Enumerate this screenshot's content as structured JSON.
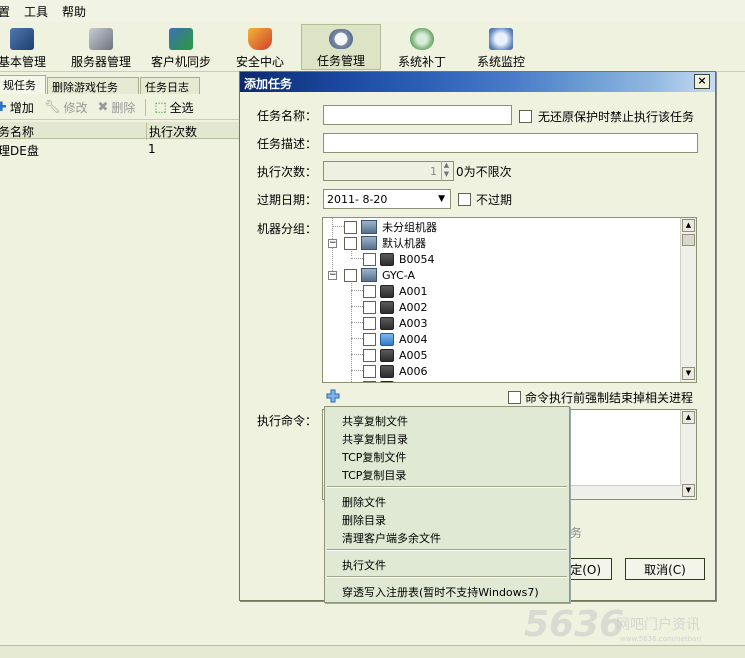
{
  "menubar": {
    "items": [
      "置",
      "工具",
      "帮助"
    ]
  },
  "toolbar": {
    "buttons": [
      {
        "label": "基本管理",
        "icon": "gear-monitor-icon"
      },
      {
        "label": "服务器管理",
        "icon": "server-icon"
      },
      {
        "label": "客户机同步",
        "icon": "sync-icon"
      },
      {
        "label": "安全中心",
        "icon": "shield-icon"
      },
      {
        "label": "任务管理",
        "icon": "task-clock-icon",
        "active": true
      },
      {
        "label": "系统补丁",
        "icon": "patch-icon"
      },
      {
        "label": "系统监控",
        "icon": "monitor-icon"
      }
    ]
  },
  "tabs": [
    {
      "label": "规任务",
      "active": true
    },
    {
      "label": "删除游戏任务"
    },
    {
      "label": "任务日志"
    }
  ],
  "actions": {
    "add": "增加",
    "edit": "修改",
    "delete": "删除",
    "select_all": "全选"
  },
  "grid": {
    "columns": [
      "务名称",
      "执行次数"
    ],
    "rows": [
      {
        "name": "理DE盘",
        "count": "1"
      }
    ]
  },
  "dialog": {
    "title": "添加任务",
    "close": "×",
    "name_label": "任务名称：",
    "no_protect_label": "无还原保护时禁止执行该任务",
    "desc_label": "任务描述：",
    "count_label": "执行次数：",
    "count_value": "1",
    "count_hint": "0为不限次",
    "expire_label": "过期日期：",
    "expire_value": "2011- 8-20",
    "no_expire_label": "不过期",
    "machines_label": "机器分组：",
    "tree": [
      {
        "label": "未分组机器",
        "type": "group",
        "level": 0
      },
      {
        "label": "默认机器",
        "type": "group",
        "level": 0,
        "expanded": true
      },
      {
        "label": "B0054",
        "type": "pc",
        "level": 1
      },
      {
        "label": "GYC-A",
        "type": "group",
        "level": 0,
        "expanded": true
      },
      {
        "label": "A001",
        "type": "pc",
        "level": 1
      },
      {
        "label": "A002",
        "type": "pc",
        "level": 1
      },
      {
        "label": "A003",
        "type": "pc",
        "level": 1
      },
      {
        "label": "A004",
        "type": "pc",
        "level": 1,
        "selected": true
      },
      {
        "label": "A005",
        "type": "pc",
        "level": 1
      },
      {
        "label": "A006",
        "type": "pc",
        "level": 1
      }
    ],
    "force_kill_label": "命令执行前强制结束掉相关进程",
    "command_label": "执行命令：",
    "partial_task_text": "务",
    "ok_label": "确定(O)",
    "ok_label_partial": "确定(O)",
    "cancel_label": "取消(C)"
  },
  "context_menu": {
    "groups": [
      [
        "共享复制文件",
        "共享复制目录",
        "TCP复制文件",
        "TCP复制目录"
      ],
      [
        "删除文件",
        "删除目录",
        "清理客户端多余文件"
      ],
      [
        "执行文件"
      ],
      [
        "穿透写入注册表(暂时不支持Windows7)"
      ]
    ]
  },
  "watermark": {
    "number": "5636",
    "text": "网吧门户资讯",
    "url": "www.5636.com/netbar/"
  },
  "colors": {
    "background": "#eef2df",
    "title_dark": "#0b2a6f",
    "title_light": "#c7dcf2",
    "menu_bg": "#dfe9d3"
  }
}
